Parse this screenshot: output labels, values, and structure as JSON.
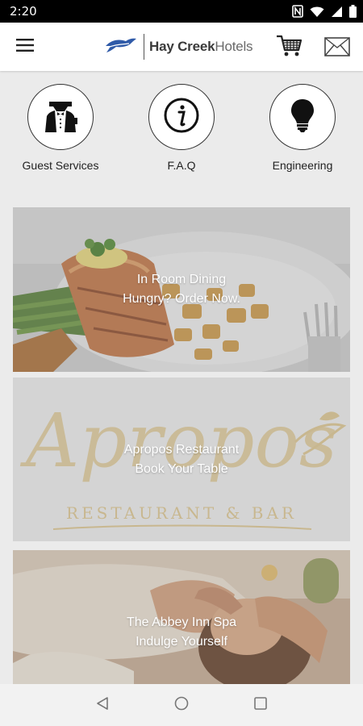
{
  "status_bar": {
    "time": "2:20",
    "icons": [
      "nfc-icon",
      "wifi-icon",
      "cell-signal-icon",
      "battery-icon"
    ]
  },
  "header": {
    "brand_name_bold": "Hay Creek",
    "brand_name_suffix": "Hotels",
    "brand_color": "#2f5aa8",
    "icons": [
      "menu-icon",
      "cart-icon",
      "mail-icon"
    ]
  },
  "quick_links": [
    {
      "label": "Guest Services",
      "icon": "butler-icon"
    },
    {
      "label": "F.A.Q",
      "icon": "info-icon"
    },
    {
      "label": "Engineering",
      "icon": "lightbulb-icon"
    }
  ],
  "cards": [
    {
      "title": "In Room Dining",
      "subtitle": "Hungry? Order Now."
    },
    {
      "title": "Apropos Restaurant",
      "subtitle": "Book Your Table",
      "logo_script": "Apropos",
      "logo_caption": "RESTAURANT & BAR",
      "logo_color": "#c9b27c"
    },
    {
      "title": "The Abbey Inn Spa",
      "subtitle": "Indulge Yourself"
    }
  ],
  "nav_bar": {
    "icons": [
      "back-icon",
      "home-icon",
      "recents-icon"
    ]
  }
}
